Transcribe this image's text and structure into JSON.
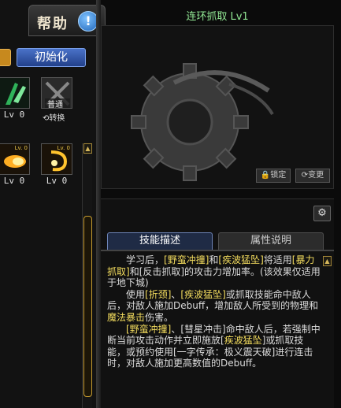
{
  "help": {
    "label": "帮助",
    "icon_glyph": "!"
  },
  "init_button": "初始化",
  "skills_top": [
    {
      "level": "Lv 0"
    },
    {
      "level": "",
      "mode": "普通",
      "convert": "⟲转换"
    }
  ],
  "skills_row2": [
    {
      "level": "Lv 0",
      "small": "Lv. 0"
    },
    {
      "level": "Lv 0",
      "small": "Lv. 0"
    }
  ],
  "skill_title": "连环抓取 Lv1",
  "preview": {
    "lock_label": "🔒锁定",
    "change_label": "⟳变更"
  },
  "tabs": {
    "active": "技能描述",
    "inactive": "属性说明"
  },
  "settings_icon": "⚙",
  "description": {
    "p1": [
      "学习后，",
      "[野蛮冲撞]",
      "和",
      "[疾波猛坠]",
      "将适用",
      "[暴力抓取]",
      "和[反击抓取]的攻击力增加率。(该效果仅适用于地下城)"
    ],
    "p2": [
      "使用",
      "[折颈]",
      "、",
      "[疾波猛坠]",
      "或抓取技能命中敌人后，对敌人施加Debuff，增加敌人所受到的物理和",
      "魔法暴击",
      "伤害。"
    ],
    "p3": [
      "",
      "[野蛮冲撞]",
      "、[彗星冲击]命中敌人后，若强制中断当前攻击动作并立即施放[",
      "疾波猛坠",
      "]或抓取技能，或预约使用[一字传承：极义震天破]进行连击时，对敌人施加更高数值的Debuff。"
    ]
  },
  "colors": {
    "highlight": "#f4dd5e",
    "title_green": "#92e894",
    "accent_blue": "#4a72c8"
  }
}
